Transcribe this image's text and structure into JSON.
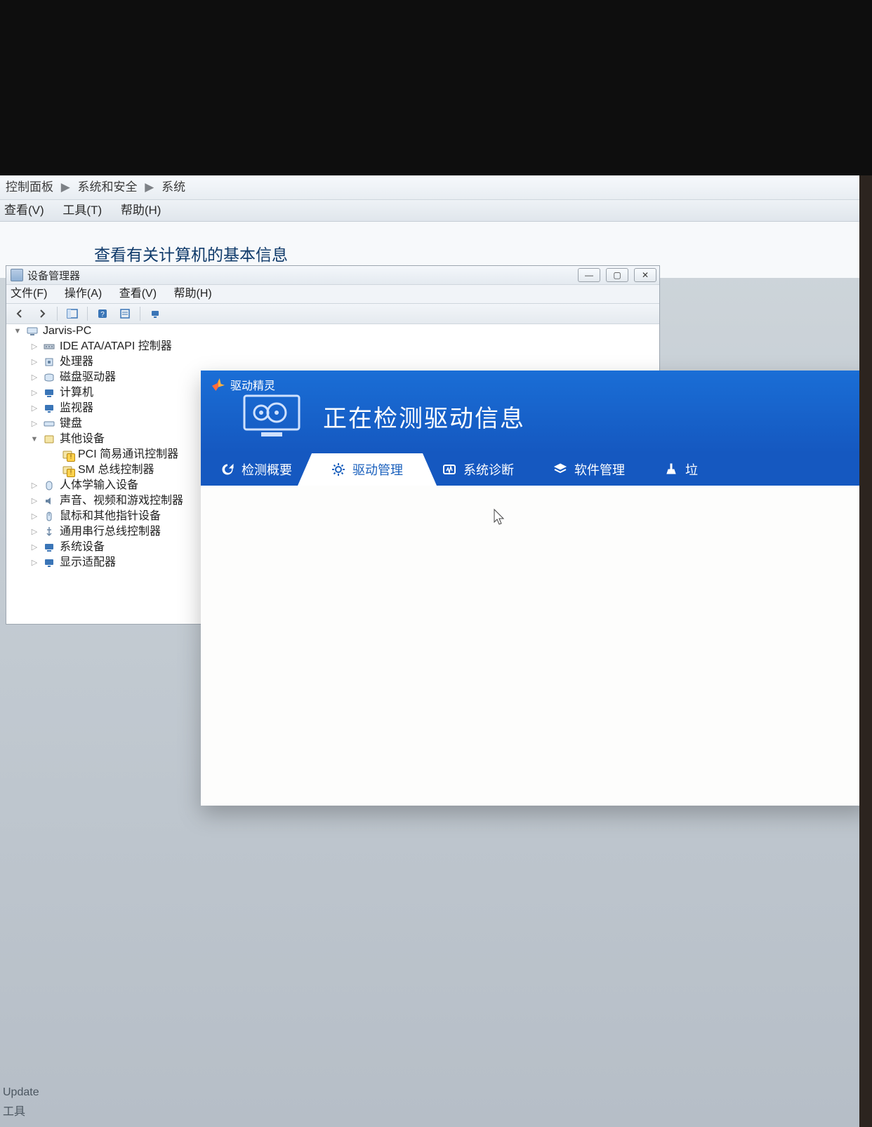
{
  "control_panel": {
    "breadcrumb": {
      "p1": "控制面板",
      "p2": "系统和安全",
      "p3": "系统"
    },
    "menubar": {
      "view": "查看(V)",
      "tools": "工具(T)",
      "help": "帮助(H)"
    },
    "heading": "查看有关计算机的基本信息"
  },
  "device_manager": {
    "title": "设备管理器",
    "menubar": {
      "file": "文件(F)",
      "action": "操作(A)",
      "view": "查看(V)",
      "help": "帮助(H)"
    },
    "root": "Jarvis-PC",
    "nodes": {
      "ide": "IDE ATA/ATAPI 控制器",
      "cpu": "处理器",
      "disk": "磁盘驱动器",
      "computer": "计算机",
      "monitor": "监视器",
      "keyboard": "键盘",
      "other": "其他设备",
      "other_pci": "PCI 简易通讯控制器",
      "other_sm": "SM 总线控制器",
      "hid": "人体学输入设备",
      "sound": "声音、视频和游戏控制器",
      "mouse": "鼠标和其他指针设备",
      "usb": "通用串行总线控制器",
      "system": "系统设备",
      "display": "显示适配器"
    }
  },
  "driver_genius": {
    "app_name": "驱动精灵",
    "headline": "正在检测驱动信息",
    "tabs": {
      "overview": "检测概要",
      "drivers": "驱动管理",
      "diagnosis": "系统诊断",
      "software": "软件管理",
      "trash": "垃"
    }
  },
  "bottom": {
    "line1": "Update",
    "line2": "工具"
  }
}
